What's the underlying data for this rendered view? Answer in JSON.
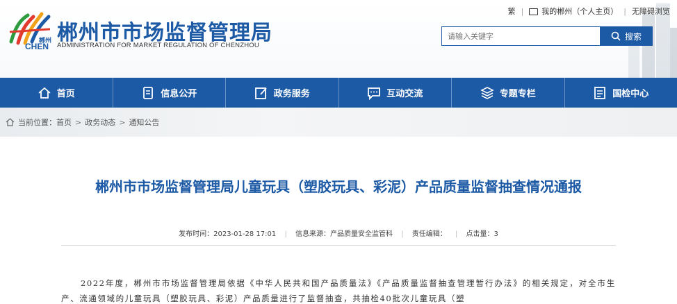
{
  "header": {
    "title": "郴州市市场监督管理局",
    "subtitle": "ADMINISTRATION FOR MARKET REGULATION OF CHENZHOU",
    "logo_cn": "郴州",
    "logo_en": "CHEN",
    "toplinks": {
      "simplified": "繁",
      "my_chenzhou": "我的郴州（个人主页）",
      "accessibility": "无障碍浏览"
    },
    "search": {
      "placeholder": "请输入关键字",
      "button_label": "搜索"
    }
  },
  "nav": [
    {
      "label": "首页",
      "icon": "home-icon"
    },
    {
      "label": "信息公开",
      "icon": "document-icon"
    },
    {
      "label": "政务服务",
      "icon": "edit-icon"
    },
    {
      "label": "互动交流",
      "icon": "chat-icon"
    },
    {
      "label": "专题专栏",
      "icon": "layers-icon"
    },
    {
      "label": "国检中心",
      "icon": "list-icon"
    }
  ],
  "breadcrumb": {
    "prefix": "当前位置：",
    "items": [
      "首页",
      "政务动态",
      "通知公告"
    ]
  },
  "article": {
    "title": "郴州市市场监督管理局儿童玩具（塑胶玩具、彩泥）产品质量监督抽查情况通报",
    "meta": {
      "publish_time_label": "发布时间：",
      "publish_time": "2023-01-28 17:01",
      "source_label": "信息来源：",
      "source": "产品质量安全监管科",
      "editor_label": "责任编辑：",
      "editor": "",
      "views_label": "点击量：",
      "views": "3"
    },
    "body": "2022年度，郴州市市场监督管理局依据《中华人民共和国产品质量法》《产品质量监督抽查管理暂行办法》的相关规定，对全市生产、流通领域的儿童玩具（塑胶玩具、彩泥）产品质量进行了监督抽查，共抽检40批次儿童玩具（塑"
  },
  "colors": {
    "brand": "#1d5aa6",
    "breadcrumb_bg": "#eef0f2"
  }
}
